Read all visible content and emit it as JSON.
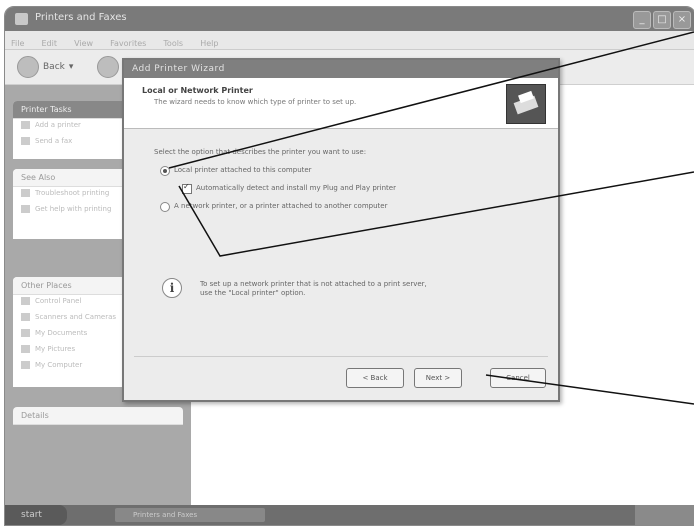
{
  "window": {
    "title": "Printers and Faxes"
  },
  "menu": [
    "File",
    "Edit",
    "View",
    "Favorites",
    "Tools",
    "Help"
  ],
  "toolbar": {
    "back_label": "Back"
  },
  "left_pane": {
    "printer_tasks": {
      "header": "Printer Tasks",
      "items": [
        "Add a printer",
        "Send a fax"
      ]
    },
    "see_also": {
      "header": "See Also",
      "items": [
        "Troubleshoot printing",
        "Get help with printing"
      ]
    },
    "other_places": {
      "header": "Other Places",
      "items": [
        "Control Panel",
        "Scanners and Cameras",
        "My Documents",
        "My Pictures",
        "My Computer"
      ]
    },
    "details": {
      "header": "Details"
    }
  },
  "dialog": {
    "title": "Add Printer Wizard",
    "header_title": "Local or Network Printer",
    "header_subtitle": "The wizard needs to know which type of printer to set up.",
    "prompt": "Select the option that describes the printer you want to use:",
    "option_local": "Local printer attached to this computer",
    "option_autodetect": "Automatically detect and install my Plug and Play printer",
    "option_network": "A network printer, or a printer attached to another computer",
    "info_text_line1": "To set up a network printer that is not attached to a print server,",
    "info_text_line2": "use the \"Local printer\" option.",
    "back_button": "< Back",
    "next_button": "Next >",
    "cancel_button": "Cancel"
  },
  "taskbar": {
    "start": "start",
    "task": "Printers and Faxes"
  }
}
